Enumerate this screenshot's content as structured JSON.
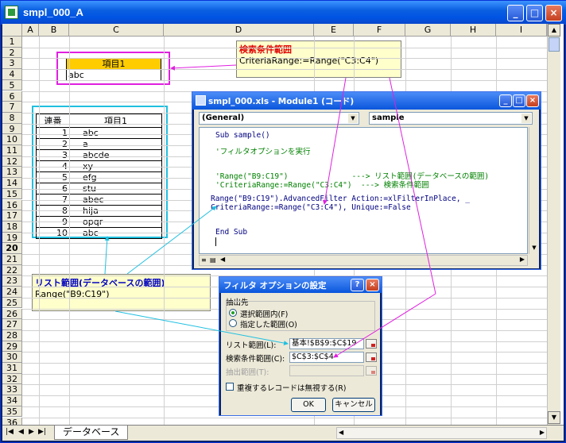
{
  "window": {
    "title": "smpl_000_A"
  },
  "columns": [
    "A",
    "B",
    "C",
    "D",
    "E",
    "F",
    "G",
    "H",
    "I"
  ],
  "rows": [
    "1",
    "2",
    "3",
    "4",
    "5",
    "6",
    "7",
    "8",
    "9",
    "10",
    "11",
    "12",
    "13",
    "14",
    "15",
    "16",
    "17",
    "18",
    "19",
    "20",
    "21",
    "22",
    "23",
    "24",
    "25",
    "26",
    "27",
    "28",
    "29",
    "30",
    "31",
    "32",
    "33",
    "34",
    "35",
    "36"
  ],
  "criteria_table": {
    "header": "項目1",
    "value": "abc"
  },
  "db_table": {
    "headers": [
      "連番",
      "項目1"
    ],
    "rows": [
      [
        "1",
        "abc"
      ],
      [
        "2",
        "a"
      ],
      [
        "3",
        "abcde"
      ],
      [
        "4",
        "xy"
      ],
      [
        "5",
        "efg"
      ],
      [
        "6",
        "stu"
      ],
      [
        "7",
        "abec"
      ],
      [
        "8",
        "hija"
      ],
      [
        "9",
        "opqr"
      ],
      [
        "10",
        "abc"
      ]
    ]
  },
  "callout_criteria": {
    "title": "検索条件範囲",
    "text": "CriteriaRange:=Range(\"C3:C4\")"
  },
  "callout_list": {
    "title": "リスト範囲(データベースの範囲)",
    "text": "Range(\"B9:C19\")"
  },
  "vbe": {
    "title": "smpl_000.xls - Module1 (コード)",
    "object_combo": "(General)",
    "proc_combo": "sample",
    "code": {
      "l1": "Sub sample()",
      "l2": "'フィルタオプションを実行",
      "l3": "'Range(\"B9:C19\")              ---> リスト範囲(データベースの範囲)",
      "l4": "'CriteriaRange:=Range(\"C3:C4\")  ---> 検索条件範囲",
      "l5": "Range(\"B9:C19\").AdvancedFilter Action:=xlFilterInPlace, _",
      "l6a": "CriteriaRange:=Range(\"C3:C4\"), Unique:=",
      "l6b": "False",
      "l7": "End Sub"
    }
  },
  "dialog": {
    "title": "フィルタ オプションの設定",
    "help": "?",
    "close": "×",
    "group": "抽出先",
    "radio1": "選択範囲内(F)",
    "radio2": "指定した範囲(O)",
    "list_label": "リスト範囲(L):",
    "list_value": "基本!$B$9:$C$19",
    "crit_label": "検索条件範囲(C):",
    "crit_value": "$C$3:$C$4",
    "extract_label": "抽出範囲(T):",
    "unique_label": "重複するレコードは無視する(R)",
    "ok": "OK",
    "cancel": "キャンセル"
  },
  "sheet_tab": "データベース",
  "colors": {
    "criteria_header": "#ffcc00",
    "pink": "#e020e0",
    "cyan": "#20c0e0",
    "callout": "#ffffcc",
    "title_red": "#e00000"
  }
}
